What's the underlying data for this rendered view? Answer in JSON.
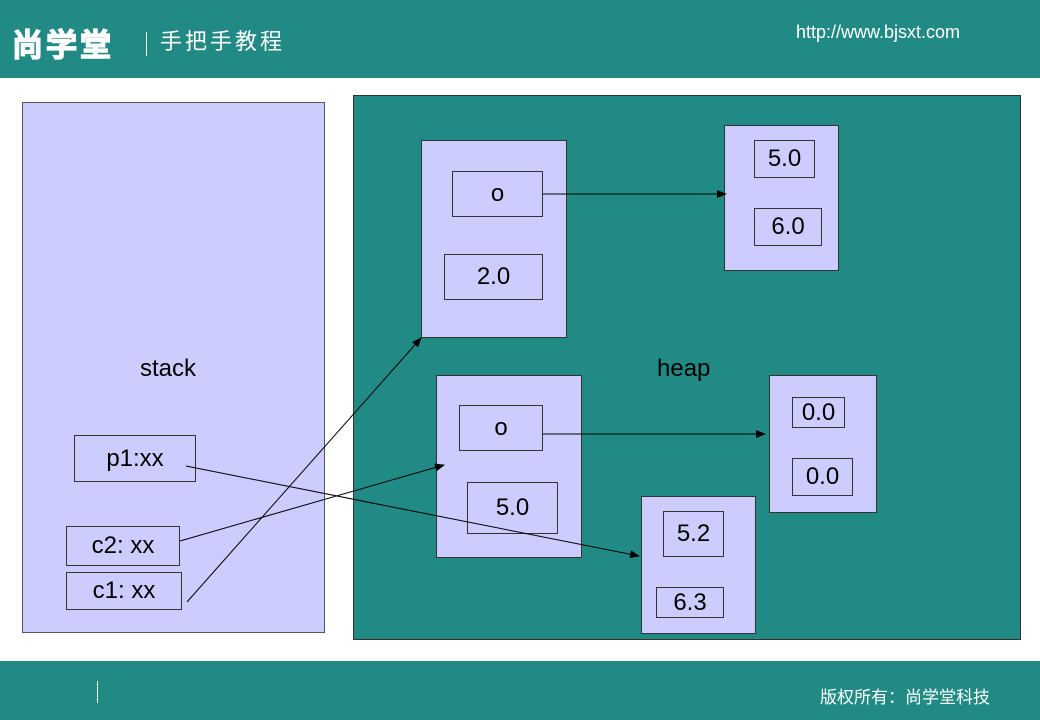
{
  "header": {
    "logo": "尚学堂",
    "slogan": "手把手教程",
    "url": "http://www.bjsxt.com"
  },
  "footer": {
    "copyright": "版权所有：尚学堂科技"
  },
  "diagram": {
    "stack_label": "stack",
    "heap_label": "heap",
    "stack_vars": {
      "p1": "p1:xx",
      "c2": "c2: xx",
      "c1": "c1: xx"
    },
    "objects": {
      "obj1": {
        "field_o": "o",
        "field_val": "2.0"
      },
      "obj2": {
        "field_o": "o",
        "field_val": "5.0"
      },
      "point_a": {
        "x": "5.0",
        "y": "6.0"
      },
      "point_b": {
        "x": "0.0",
        "y": "0.0"
      },
      "point_c": {
        "x": "5.2",
        "y": "6.3"
      }
    }
  }
}
